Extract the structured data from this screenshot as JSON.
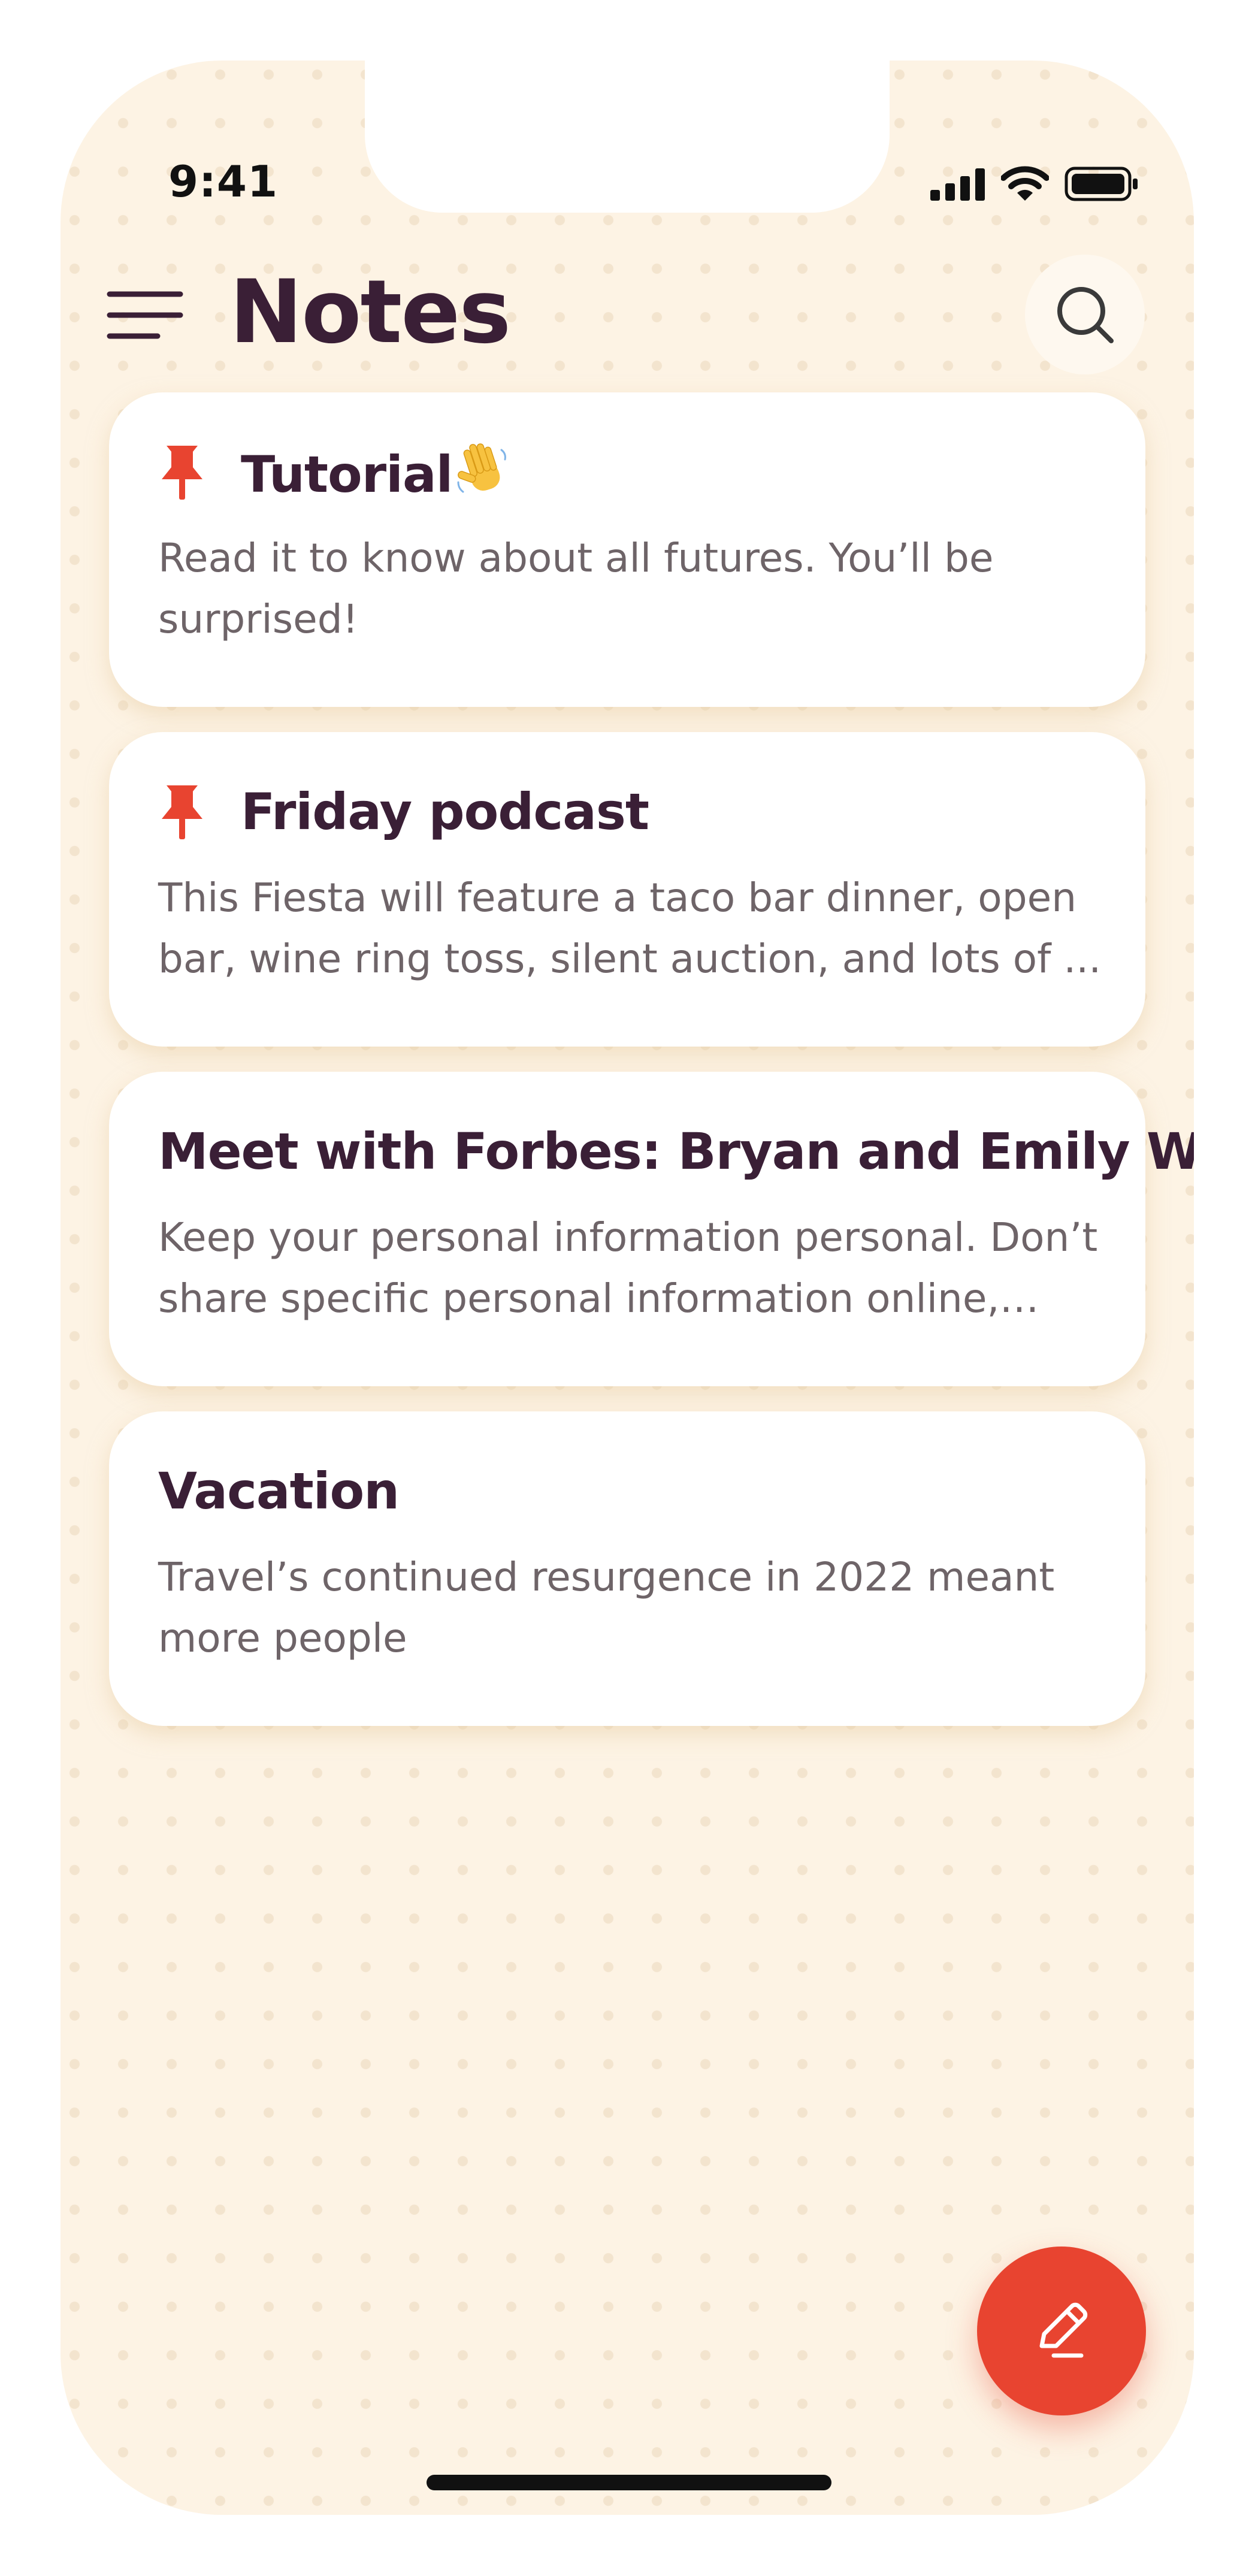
{
  "status_bar": {
    "time": "9:41"
  },
  "header": {
    "title": "Notes",
    "menu_icon": "hamburger-menu-icon",
    "search_icon": "search-icon"
  },
  "notes": [
    {
      "title": "Tutorial",
      "emoji": "waving-hand",
      "pinned": true,
      "snippet": "Read it to know about all futures. You’ll be surprised!"
    },
    {
      "title": "Friday podcast",
      "pinned": true,
      "snippet": "This Fiesta will feature a taco bar dinner, open bar, wine ring toss, silent auction, and lots of ..."
    },
    {
      "title": "Meet with Forbes: Bryan and Emily W...",
      "pinned": false,
      "snippet": "Keep your personal information personal. Don’t share specific personal information online,…"
    },
    {
      "title": "Vacation",
      "pinned": false,
      "snippet": "Travel’s continued resurgence in 2022 meant more people"
    }
  ],
  "fab": {
    "icon": "pencil-icon"
  },
  "colors": {
    "background": "#FDF3E4",
    "accent": "#E84430",
    "title_text": "#3A1F36",
    "snippet_text": "#6E6468",
    "card": "#FFFFFF"
  }
}
